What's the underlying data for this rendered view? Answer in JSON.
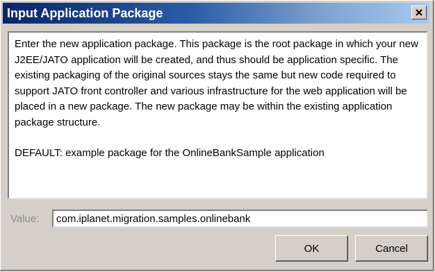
{
  "window": {
    "title": "Input Application Package",
    "close_icon": "close-icon"
  },
  "message": {
    "paragraph": "Enter the new application package.  This package is the root package in which your new J2EE/JATO application will be created, and thus should be application specific.  The existing packaging of the original sources stays the same but new code required to support JATO front controller and various infrastructure for the web application will be placed in a new package.  The new package may be within the existing application package structure.",
    "default_line": "DEFAULT: example package for the OnlineBankSample application"
  },
  "value_field": {
    "label": "Value:",
    "value": "com.iplanet.migration.samples.onlinebank"
  },
  "buttons": {
    "ok": "OK",
    "cancel": "Cancel"
  },
  "colors": {
    "title_bar_start": "#0a246a",
    "title_bar_end": "#a6caf0",
    "dialog_face": "#d4d0c8"
  }
}
